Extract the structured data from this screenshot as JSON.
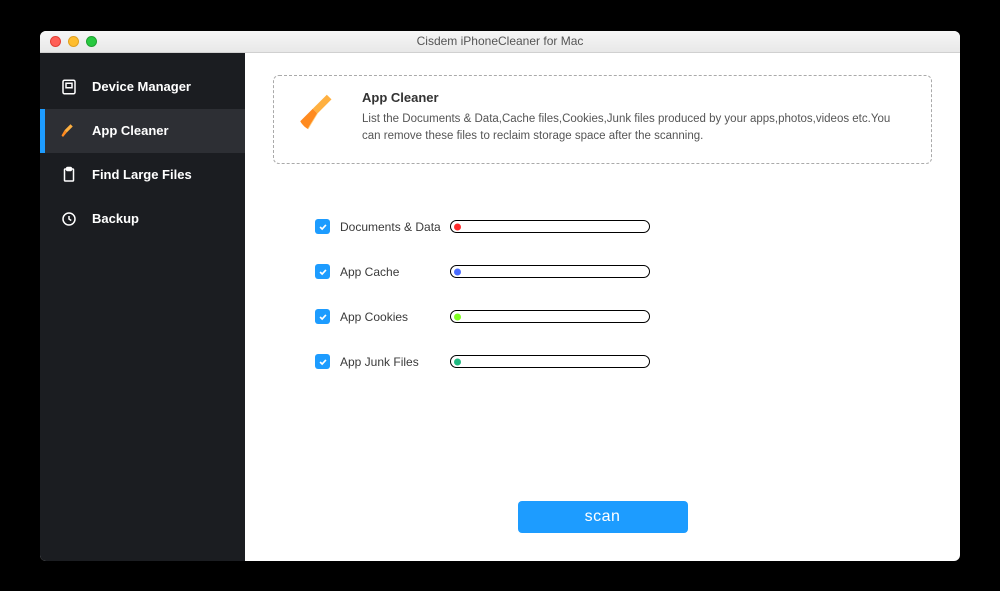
{
  "window": {
    "title": "Cisdem iPhoneCleaner for Mac"
  },
  "sidebar": {
    "items": [
      {
        "label": "Device Manager",
        "icon": "device-icon",
        "active": false
      },
      {
        "label": "App Cleaner",
        "icon": "broom-icon",
        "active": true
      },
      {
        "label": "Find Large Files",
        "icon": "clipboard-icon",
        "active": false
      },
      {
        "label": "Backup",
        "icon": "backup-icon",
        "active": false
      }
    ]
  },
  "header": {
    "title": "App Cleaner",
    "description": "List the Documents & Data,Cache files,Cookies,Junk files produced by your apps,photos,videos etc.You can remove these files to reclaim storage space after the scanning."
  },
  "categories": [
    {
      "label": "Documents & Data",
      "checked": true,
      "color": "#ff2b2b"
    },
    {
      "label": "App Cache",
      "checked": true,
      "color": "#4a6cff"
    },
    {
      "label": "App Cookies",
      "checked": true,
      "color": "#7fff1f"
    },
    {
      "label": "App Junk Files",
      "checked": true,
      "color": "#1fb880"
    }
  ],
  "actions": {
    "scan": "scan"
  }
}
